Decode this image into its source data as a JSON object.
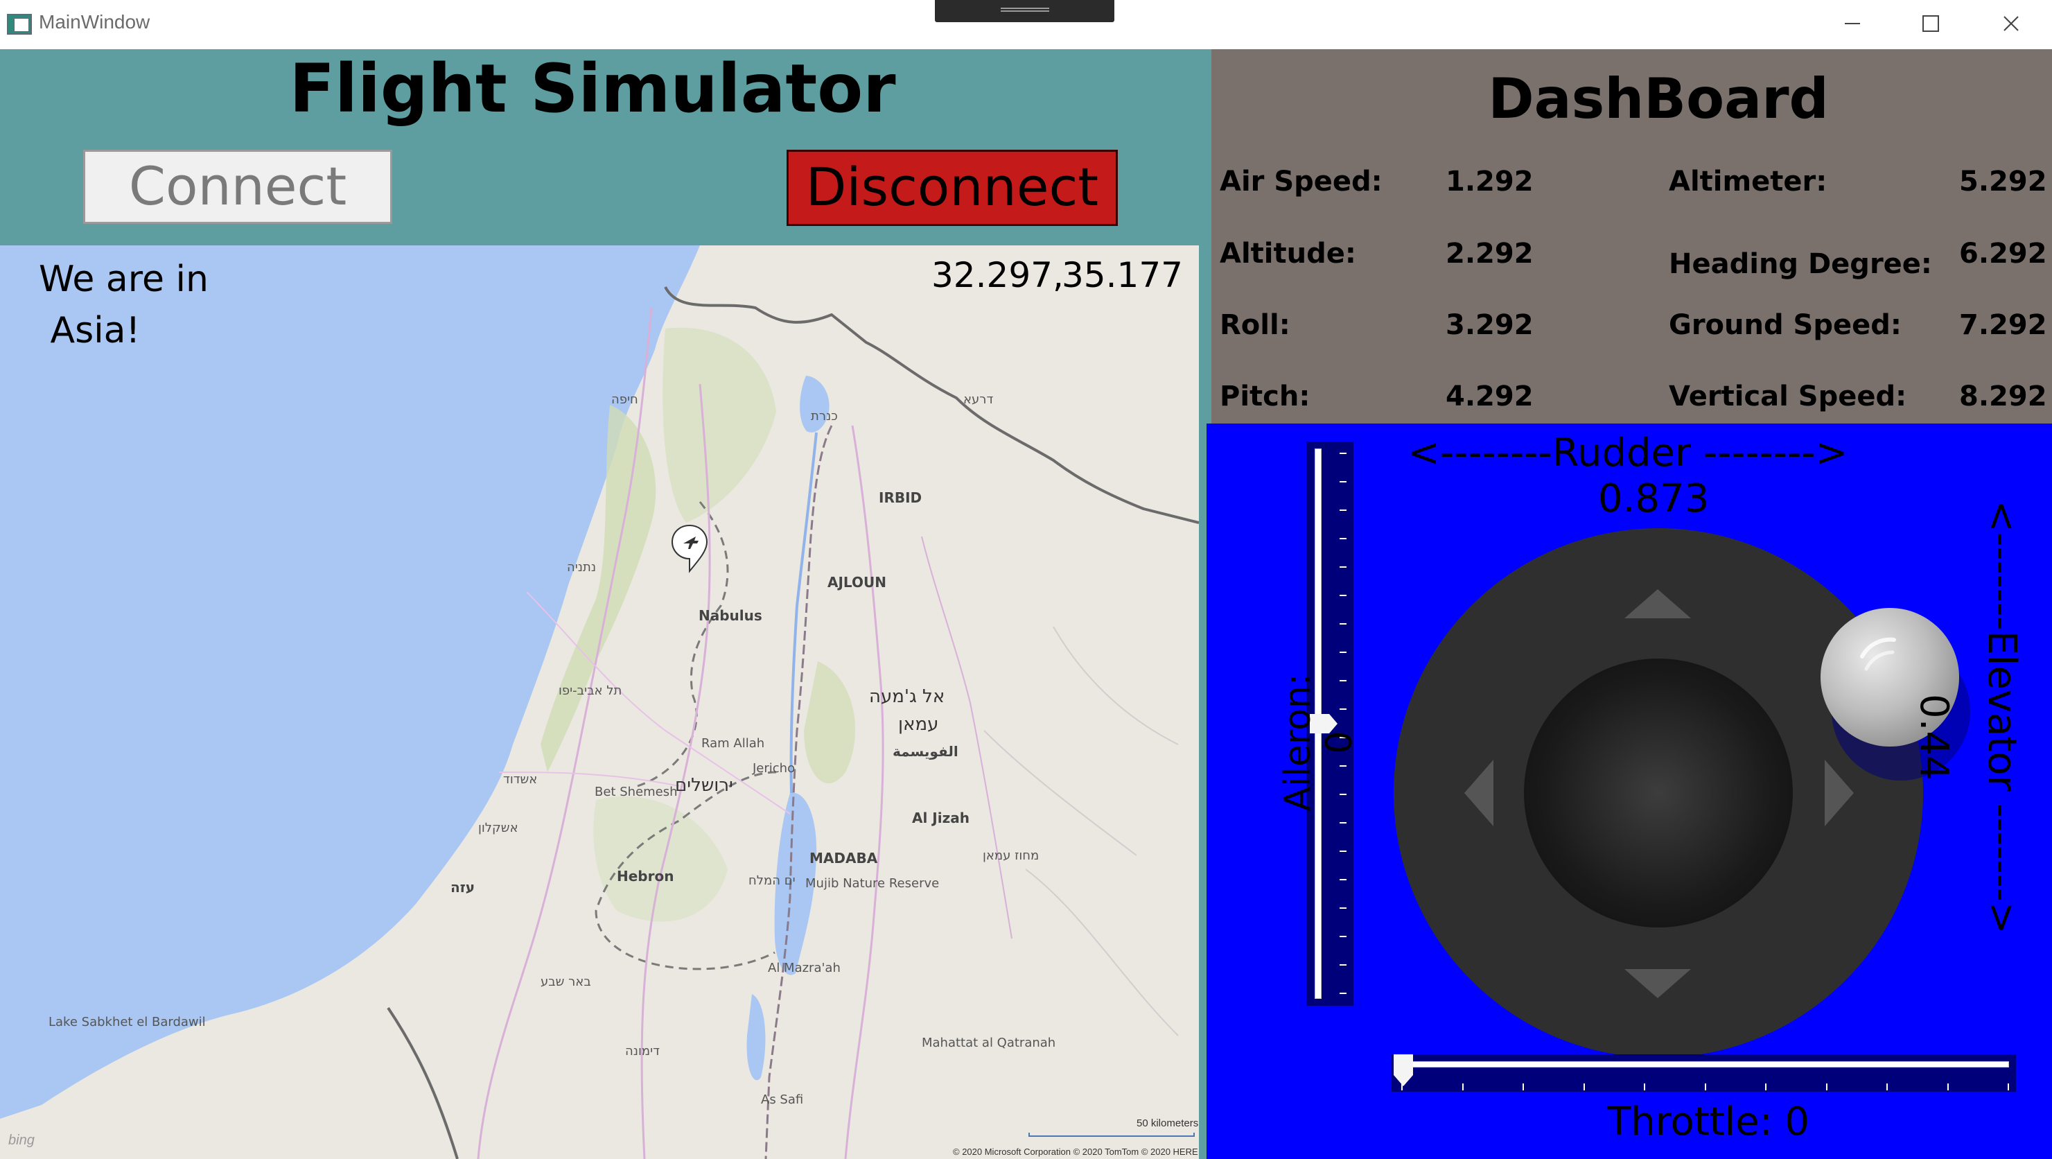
{
  "window": {
    "title": "MainWindow",
    "minimize_icon": "minimize-icon",
    "maximize_icon": "maximize-icon",
    "close_icon": "close-icon"
  },
  "header": {
    "title": "Flight Simulator",
    "connect_label": "Connect",
    "disconnect_label": "Disconnect",
    "disconnect_color": "#c41a1a"
  },
  "map": {
    "region_text": "We are in\n Asia!",
    "latitude": "32.297,",
    "longitude": "35.177",
    "marker_icon": "airplane-pin-icon",
    "scale_label": "50 kilometers",
    "copyright": "© 2020 Microsoft Corporation   © 2020 TomTom © 2020 HERE",
    "logo": "bing",
    "labels": [
      {
        "text": "Nabulus",
        "cls": "big"
      },
      {
        "text": "IRBID",
        "cls": "big"
      },
      {
        "text": "AJLOUN",
        "cls": "big"
      },
      {
        "text": "Ram Allah",
        "cls": ""
      },
      {
        "text": "Jericho",
        "cls": ""
      },
      {
        "text": "Bet Shemesh",
        "cls": ""
      },
      {
        "text": "ירושלים",
        "cls": "huge"
      },
      {
        "text": "Hebron",
        "cls": "big"
      },
      {
        "text": "MADABA",
        "cls": "big"
      },
      {
        "text": "Al Jizah",
        "cls": "big"
      },
      {
        "text": "Mujib Nature Reserve",
        "cls": ""
      },
      {
        "text": "Al Mazra'ah",
        "cls": ""
      },
      {
        "text": "Mahattat al Qatranah",
        "cls": ""
      },
      {
        "text": "As Safi",
        "cls": ""
      },
      {
        "text": "Lake Sabkhet el Bardawil",
        "cls": ""
      },
      {
        "text": "אל ג'מעה",
        "cls": "huge"
      },
      {
        "text": "עמאן",
        "cls": "huge"
      },
      {
        "text": "الفويسمة",
        "cls": "big"
      },
      {
        "text": "חיפה",
        "cls": ""
      },
      {
        "text": "נתניה",
        "cls": ""
      },
      {
        "text": "תל אביב-יפו",
        "cls": ""
      },
      {
        "text": "אשדוד",
        "cls": ""
      },
      {
        "text": "אשקלון",
        "cls": ""
      },
      {
        "text": "עזה",
        "cls": "big"
      },
      {
        "text": "באר שבע",
        "cls": ""
      },
      {
        "text": "דימונה",
        "cls": ""
      },
      {
        "text": "ים המלח",
        "cls": ""
      },
      {
        "text": "כנרת",
        "cls": ""
      },
      {
        "text": "דרעא",
        "cls": ""
      },
      {
        "text": "מחוז עמאן",
        "cls": ""
      }
    ]
  },
  "dashboard": {
    "title": "DashBoard",
    "items": [
      {
        "label": "Air Speed:",
        "value": "1.292"
      },
      {
        "label": "Altitude:",
        "value": "2.292"
      },
      {
        "label": "Roll:",
        "value": "3.292"
      },
      {
        "label": "Pitch:",
        "value": "4.292"
      },
      {
        "label": "Altimeter:",
        "value": "5.292"
      },
      {
        "label": "Heading Degree:",
        "value": "6.292"
      },
      {
        "label": "Ground Speed:",
        "value": "7.292"
      },
      {
        "label": "Vertical Speed:",
        "value": "8.292"
      }
    ]
  },
  "controls": {
    "background": "#0000ff",
    "rudder_label": "<--------Rudder -------->",
    "rudder_value": "0.873",
    "elevator_label": "<-------Elevator ------->",
    "elevator_value": "0.44",
    "aileron_label": "Aileron: 0",
    "aileron_level": 0.5,
    "throttle_label": "Throttle: 0",
    "throttle_level": 0
  }
}
